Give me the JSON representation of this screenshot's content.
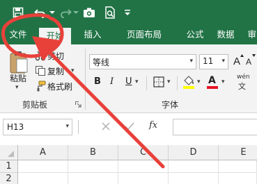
{
  "colors": {
    "brand": "#217346",
    "annotation": "#e8413a"
  },
  "quick_access": [
    {
      "name": "save-icon"
    },
    {
      "name": "undo-icon"
    },
    {
      "name": "redo-icon"
    },
    {
      "name": "camera-icon"
    },
    {
      "name": "print-preview-icon"
    },
    {
      "name": "customize-quick-access-icon"
    }
  ],
  "tabs": [
    "文件",
    "开始",
    "插入",
    "页面布局",
    "公式",
    "数据",
    "审阅"
  ],
  "active_tab": "开始",
  "clipboard": {
    "paste": "粘贴",
    "cut": "剪切",
    "copy": "复制",
    "format_painter": "格式刷",
    "group_label": "剪贴板"
  },
  "font": {
    "name": "等线",
    "size": "11",
    "bold": "B",
    "italic": "I",
    "underline": "U",
    "font_color_letter": "A",
    "phonetic": "wén",
    "group_label": "字体"
  },
  "name_box": "H13",
  "fx": "fx",
  "columns": [
    "A",
    "B",
    "C",
    "D",
    "E"
  ],
  "rows": [
    "1",
    "2"
  ],
  "annotation": {
    "shape": "circled-arrow",
    "target": "文件"
  }
}
